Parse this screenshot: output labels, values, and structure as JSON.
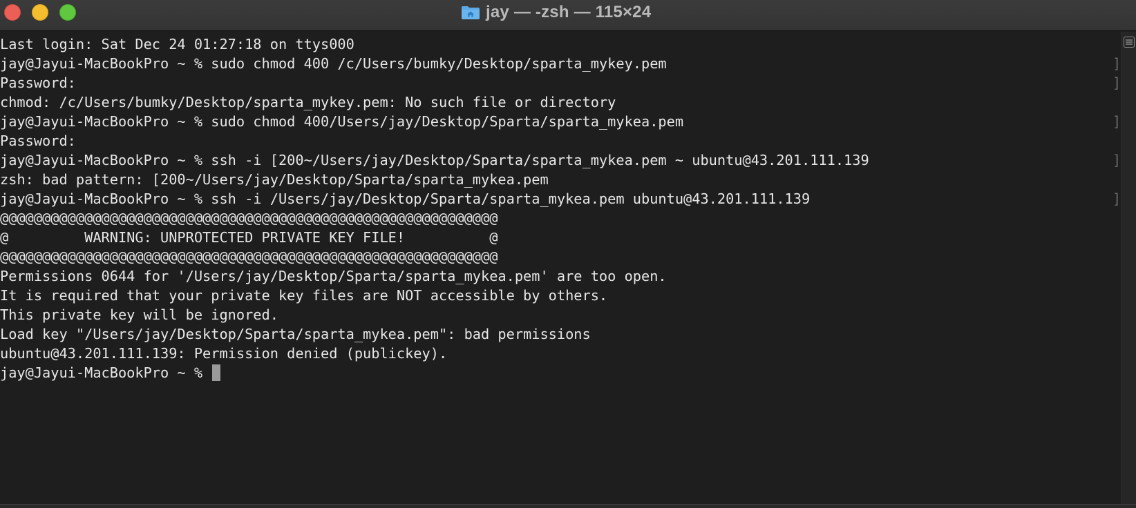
{
  "window": {
    "title": "jay — -zsh — 115×24"
  },
  "terminal": {
    "lines": [
      "Last login: Sat Dec 24 01:27:18 on ttys000",
      "jay@Jayui-MacBookPro ~ % sudo chmod 400 /c/Users/bumky/Desktop/sparta_mykey.pem",
      "Password:",
      "chmod: /c/Users/bumky/Desktop/sparta_mykey.pem: No such file or directory",
      "jay@Jayui-MacBookPro ~ % sudo chmod 400/Users/jay/Desktop/Sparta/sparta_mykea.pem",
      "Password:",
      "jay@Jayui-MacBookPro ~ % ssh -i [200~/Users/jay/Desktop/Sparta/sparta_mykea.pem ~ ubuntu@43.201.111.139",
      "zsh: bad pattern: [200~/Users/jay/Desktop/Sparta/sparta_mykea.pem",
      "jay@Jayui-MacBookPro ~ % ssh -i /Users/jay/Desktop/Sparta/sparta_mykea.pem ubuntu@43.201.111.139",
      "@@@@@@@@@@@@@@@@@@@@@@@@@@@@@@@@@@@@@@@@@@@@@@@@@@@@@@@@@@@",
      "@         WARNING: UNPROTECTED PRIVATE KEY FILE!          @",
      "@@@@@@@@@@@@@@@@@@@@@@@@@@@@@@@@@@@@@@@@@@@@@@@@@@@@@@@@@@@",
      "Permissions 0644 for '/Users/jay/Desktop/Sparta/sparta_mykea.pem' are too open.",
      "It is required that your private key files are NOT accessible by others.",
      "This private key will be ignored.",
      "Load key \"/Users/jay/Desktop/Sparta/sparta_mykea.pem\": bad permissions",
      "ubuntu@43.201.111.139: Permission denied (publickey).",
      "jay@Jayui-MacBookPro ~ % "
    ],
    "mark_glyph": "]"
  },
  "colors": {
    "close": "#ec5f57",
    "minimize": "#f4be2f",
    "maximize": "#5fc83f",
    "background": "#1e1e1e",
    "text": "#e6e6e6",
    "folder": "#5aa9e6"
  },
  "icons": {
    "folder": "home-folder-icon",
    "scroll": "list-icon"
  }
}
